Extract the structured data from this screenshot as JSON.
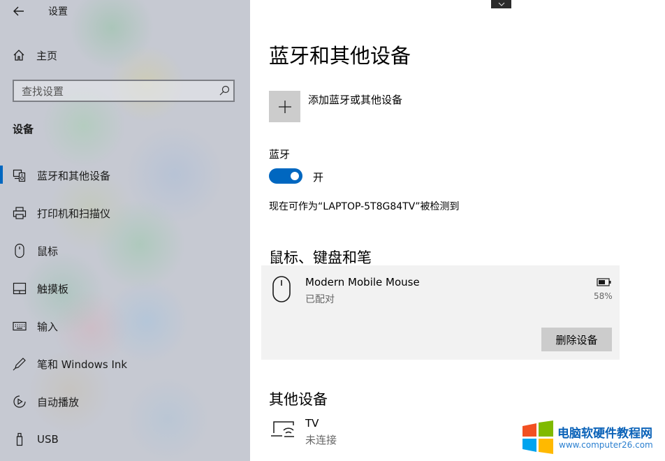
{
  "window": {
    "title": "设置"
  },
  "sidebar": {
    "home_label": "主页",
    "search_placeholder": "查找设置",
    "section_title": "设备",
    "items": [
      {
        "label": "蓝牙和其他设备",
        "icon": "bluetooth-devices-icon",
        "active": true
      },
      {
        "label": "打印机和扫描仪",
        "icon": "printer-icon"
      },
      {
        "label": "鼠标",
        "icon": "mouse-icon"
      },
      {
        "label": "触摸板",
        "icon": "touchpad-icon"
      },
      {
        "label": "输入",
        "icon": "keyboard-icon"
      },
      {
        "label": "笔和 Windows Ink",
        "icon": "pen-icon"
      },
      {
        "label": "自动播放",
        "icon": "autoplay-icon"
      },
      {
        "label": "USB",
        "icon": "usb-icon"
      }
    ]
  },
  "main": {
    "title": "蓝牙和其他设备",
    "add_device_label": "添加蓝牙或其他设备",
    "bluetooth": {
      "label": "蓝牙",
      "state_label": "开",
      "discoverable_text": "现在可作为“LAPTOP-5T8G84TV”被检测到"
    },
    "mouse_section": {
      "title": "鼠标、键盘和笔",
      "device": {
        "name": "Modern Mobile Mouse",
        "status": "已配对",
        "battery": "58%",
        "remove_label": "删除设备"
      }
    },
    "other_section": {
      "title": "其他设备",
      "device": {
        "name": "TV",
        "status": "未连接"
      }
    }
  },
  "watermark": {
    "line1": "电脑软硬件教程网",
    "line2": "www.computer26.com"
  },
  "colors": {
    "accent": "#0067c0",
    "sidebar_bg": "#c6c9d2",
    "tile_gray": "#cccccc",
    "card_bg": "#f2f2f2"
  }
}
